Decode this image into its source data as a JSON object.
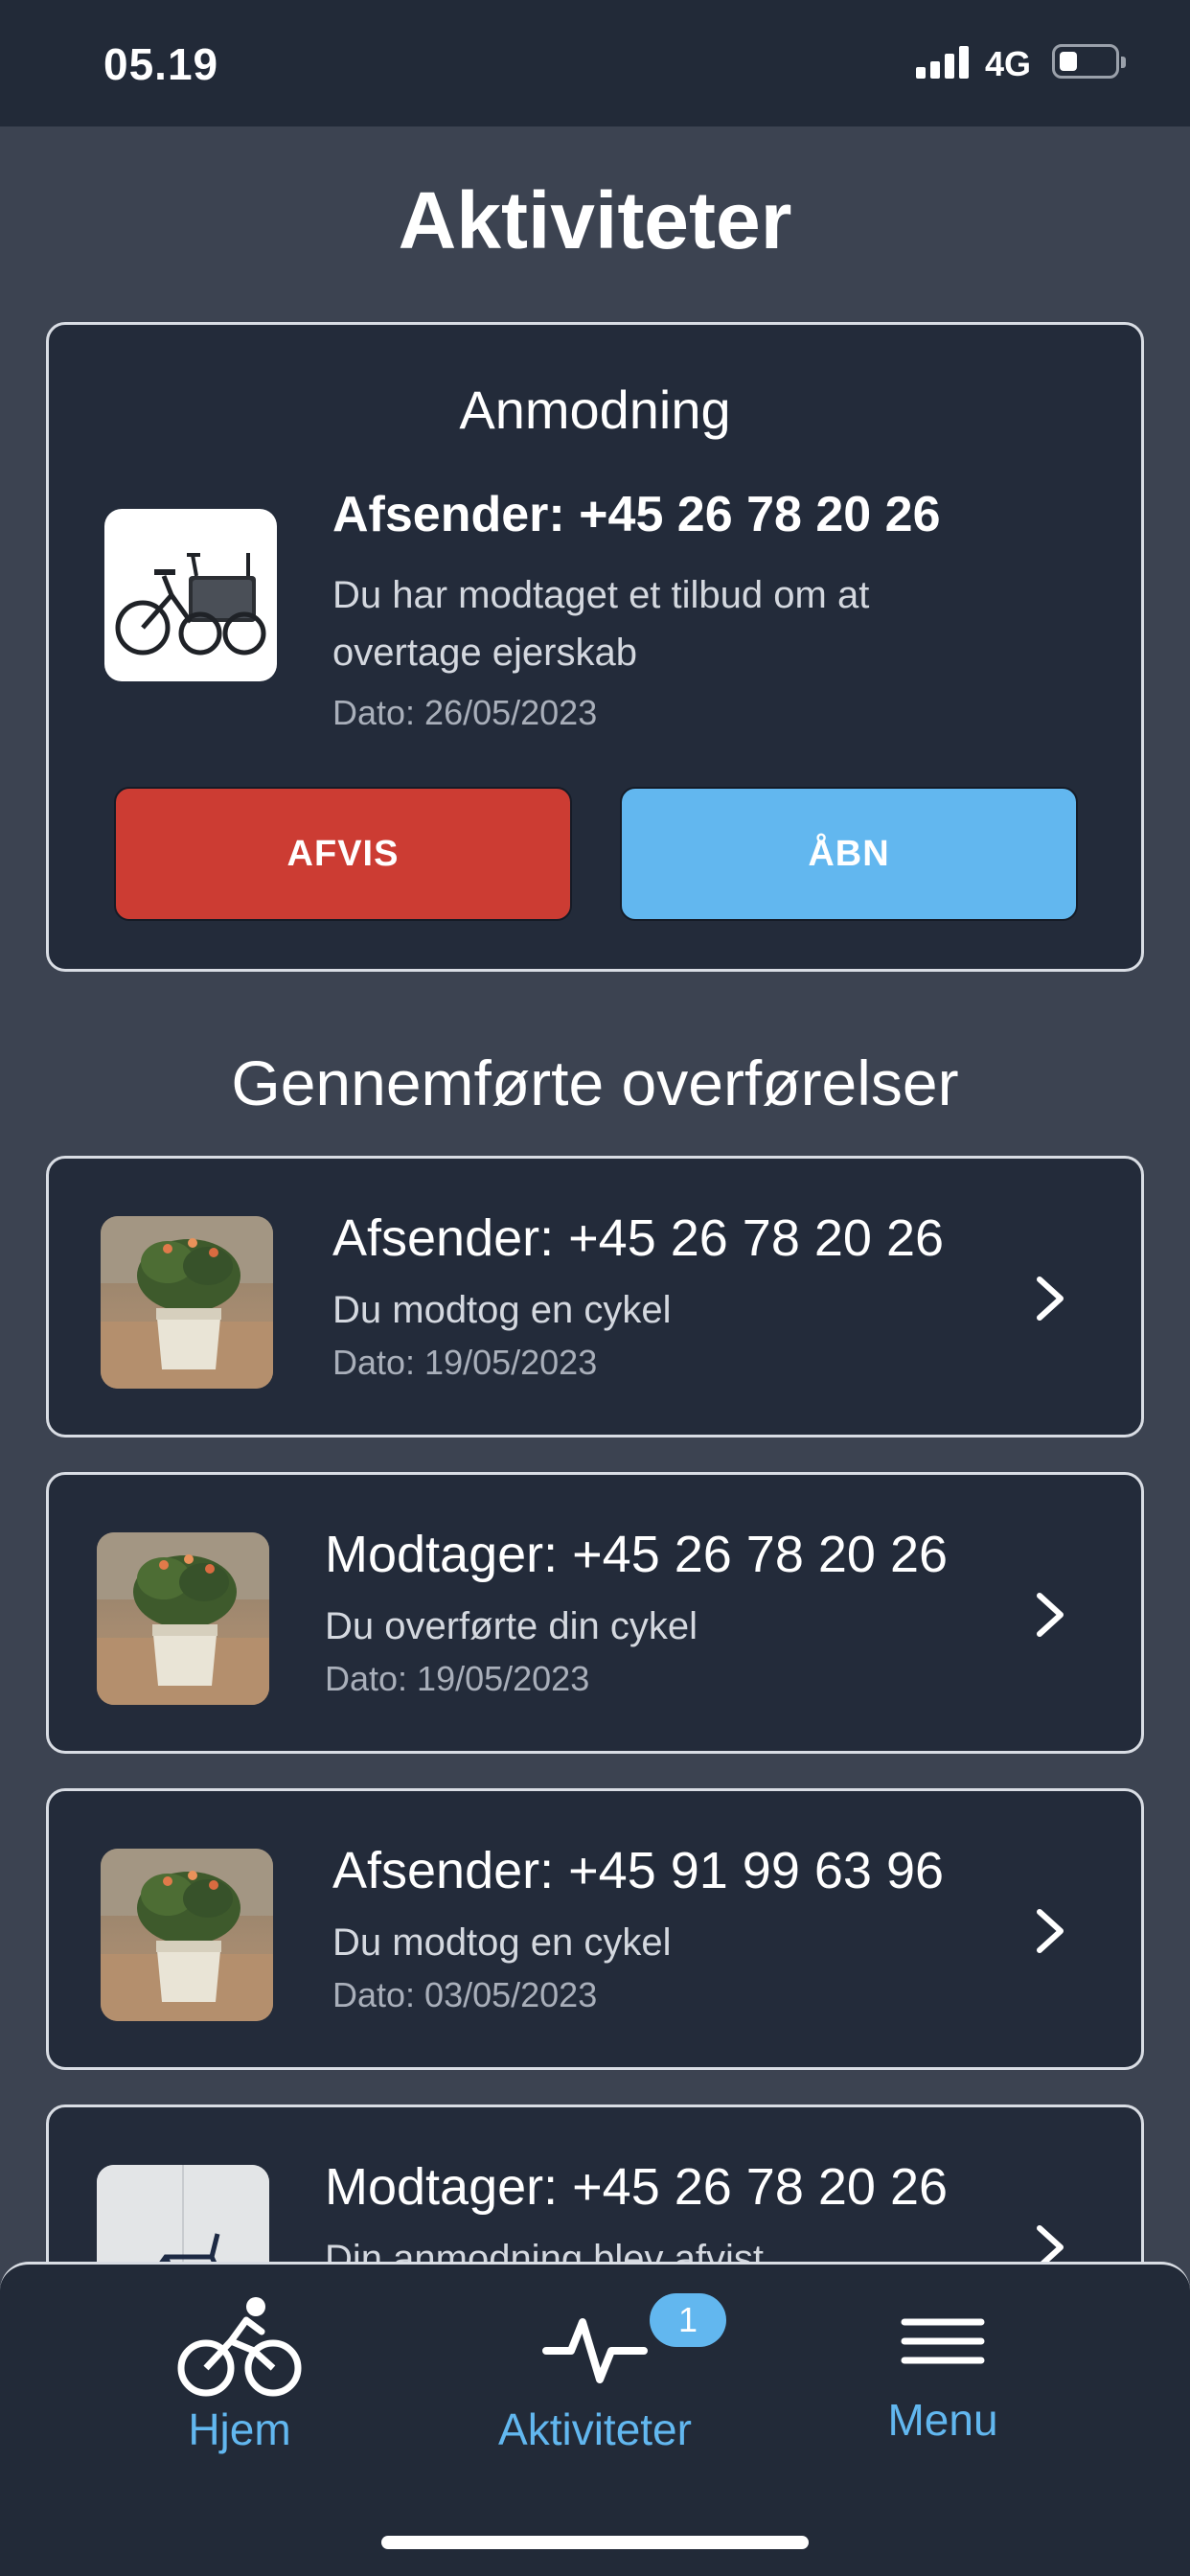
{
  "status_bar": {
    "time": "05.19",
    "network": "4G"
  },
  "page_title": "Aktiviteter",
  "request": {
    "heading": "Anmodning",
    "sender": "Afsender: +45 26 78 20 26",
    "description": "Du har modtaget et tilbud om at overtage ejerskab",
    "date": "Dato: 26/05/2023",
    "reject_label": "AFVIS",
    "open_label": "ÅBN",
    "thumbnail": "cargo-bike"
  },
  "completed_section_title": "Gennemførte overførelser",
  "transfers": [
    {
      "title": "Afsender: +45 26 78 20 26",
      "description": "Du modtog en cykel",
      "date": "Dato: 19/05/2023",
      "thumbnail": "plant-photo"
    },
    {
      "title": "Modtager: +45 26 78 20 26",
      "description": "Du overførte din cykel",
      "date": "Dato: 19/05/2023",
      "thumbnail": "plant-photo"
    },
    {
      "title": "Afsender: +45 91 99 63 96",
      "description": "Du modtog en cykel",
      "date": "Dato: 03/05/2023",
      "thumbnail": "plant-photo"
    },
    {
      "title": "Modtager: +45 26 78 20 26",
      "description": "Din anmodning blev afvist",
      "thumbnail": "bike-photo"
    }
  ],
  "tabbar": {
    "home_label": "Hjem",
    "activities_label": "Aktiviteter",
    "activities_badge": "1",
    "menu_label": "Menu"
  },
  "colors": {
    "background": "#3c4351",
    "card": "#232b3a",
    "accent": "#62b7ef",
    "reject": "#cc3c33"
  }
}
